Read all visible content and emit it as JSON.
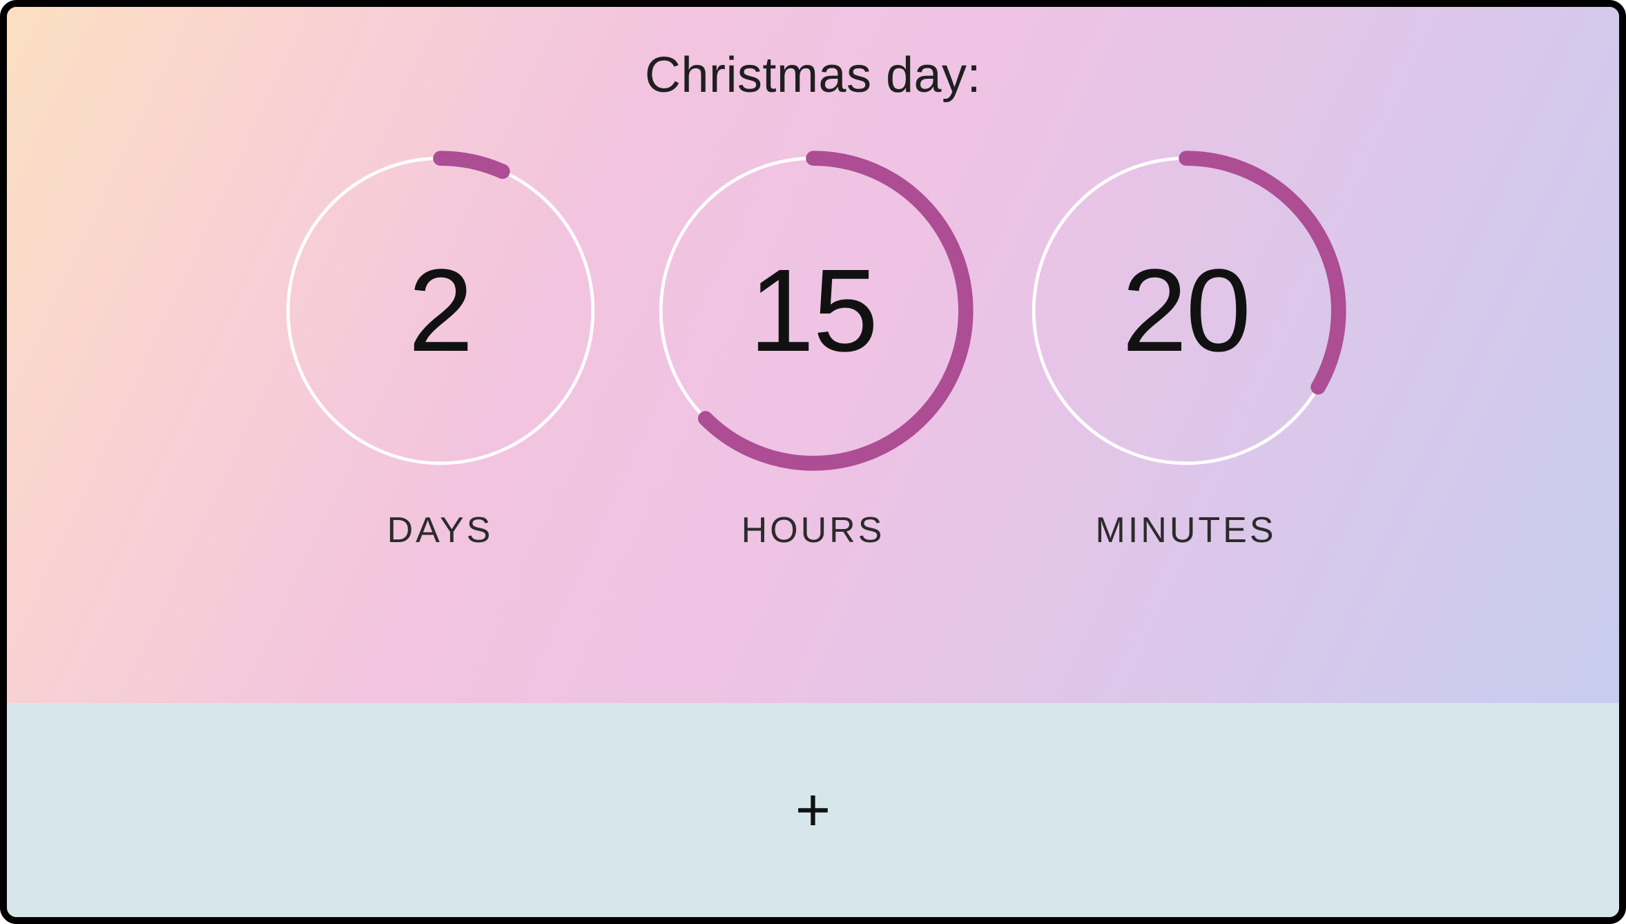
{
  "countdown": {
    "title": "Christmas day:",
    "accent_color": "#ad4d94",
    "track_color": "#ffffff",
    "rings": [
      {
        "value": "2",
        "label": "DAYS",
        "max": 30,
        "filled": 2
      },
      {
        "value": "15",
        "label": "HOURS",
        "max": 24,
        "filled": 15
      },
      {
        "value": "20",
        "label": "MINUTES",
        "max": 60,
        "filled": 20
      }
    ]
  },
  "add_button": {
    "symbol": "+"
  }
}
